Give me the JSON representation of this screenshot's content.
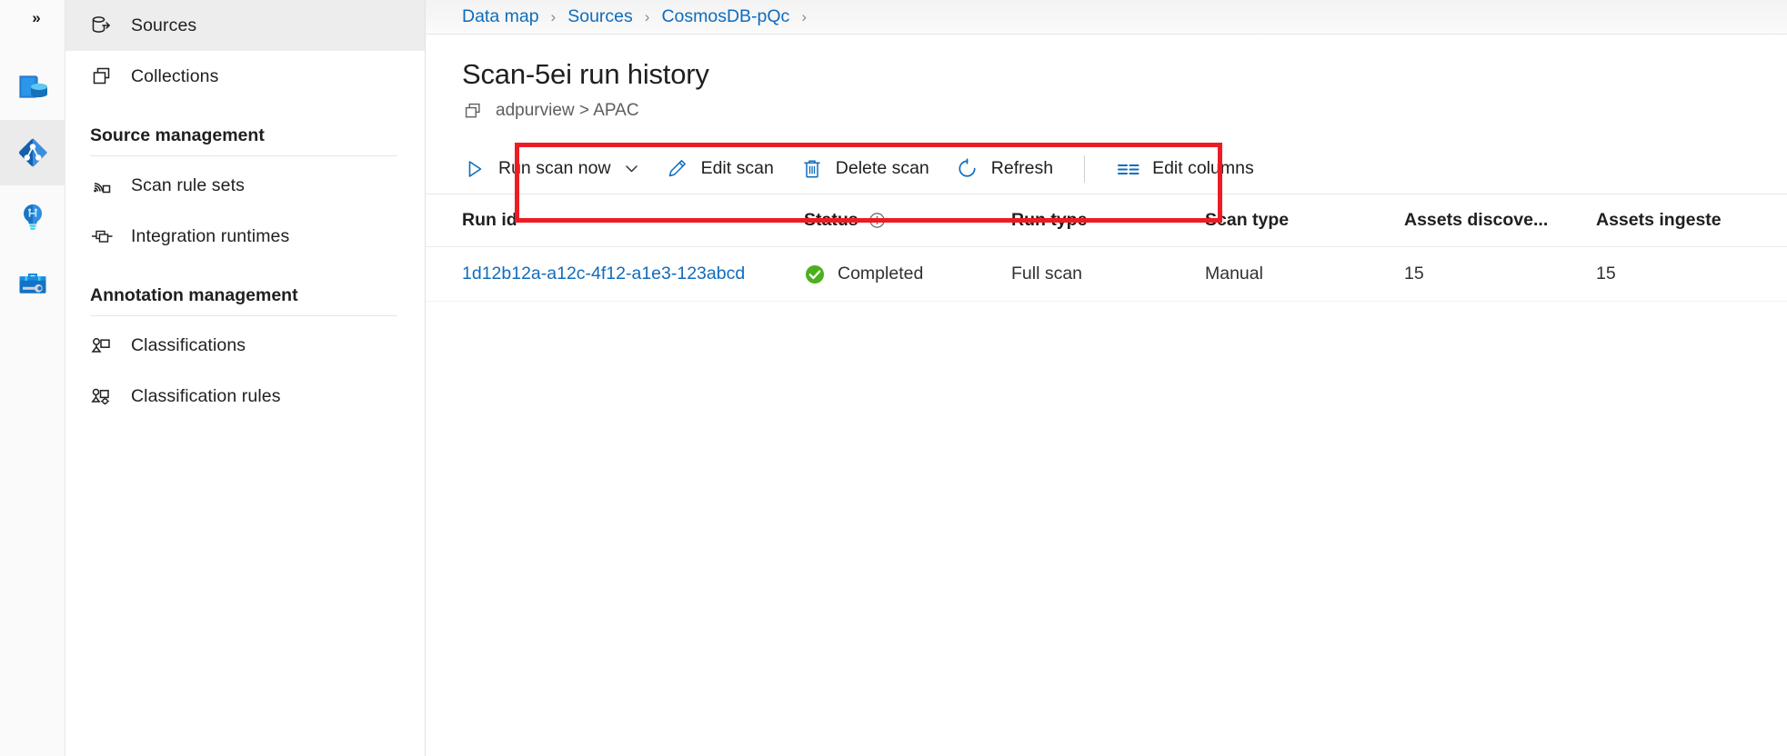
{
  "rail": {
    "items": [
      {
        "name": "data-catalog",
        "icon": "book-database-icon"
      },
      {
        "name": "data-map",
        "icon": "data-map-icon",
        "selected": true
      },
      {
        "name": "data-insights",
        "icon": "lightbulb-icon"
      },
      {
        "name": "management",
        "icon": "toolbox-icon"
      }
    ]
  },
  "sidebar": {
    "collapse_label": "»",
    "items": [
      {
        "label": "Sources",
        "icon": "sources-icon",
        "selected": true
      },
      {
        "label": "Collections",
        "icon": "collections-icon",
        "selected": false
      }
    ],
    "groups": [
      {
        "title": "Source management",
        "items": [
          {
            "label": "Scan rule sets",
            "icon": "scan-rule-sets-icon"
          },
          {
            "label": "Integration runtimes",
            "icon": "integration-runtimes-icon"
          }
        ]
      },
      {
        "title": "Annotation management",
        "items": [
          {
            "label": "Classifications",
            "icon": "classifications-icon"
          },
          {
            "label": "Classification rules",
            "icon": "classification-rules-icon"
          }
        ]
      }
    ]
  },
  "breadcrumb": {
    "items": [
      "Data map",
      "Sources",
      "CosmosDB-pQc"
    ],
    "separator": "›"
  },
  "page": {
    "title": "Scan-5ei run history",
    "subtitle": "adpurview > APAC",
    "subtitle_icon": "collections-icon"
  },
  "toolbar": {
    "commands": [
      {
        "label": "Run scan now",
        "icon": "play-icon",
        "has_chevron": true
      },
      {
        "label": "Edit scan",
        "icon": "pencil-icon",
        "has_chevron": false
      },
      {
        "label": "Delete scan",
        "icon": "trash-icon",
        "has_chevron": false
      },
      {
        "label": "Refresh",
        "icon": "refresh-icon",
        "has_chevron": false
      }
    ],
    "secondary": [
      {
        "label": "Edit columns",
        "icon": "edit-columns-icon"
      }
    ]
  },
  "table": {
    "columns": [
      {
        "key": "run_id",
        "label": "Run id",
        "info": false
      },
      {
        "key": "status",
        "label": "Status",
        "info": true
      },
      {
        "key": "run_type",
        "label": "Run type",
        "info": false
      },
      {
        "key": "scan_type",
        "label": "Scan type",
        "info": false
      },
      {
        "key": "assets_discovered",
        "label": "Assets discove...",
        "info": false
      },
      {
        "key": "assets_ingested",
        "label": "Assets ingeste",
        "info": false
      }
    ],
    "info_icon": "info-icon",
    "rows": [
      {
        "run_id": "1d12b12a-a12c-4f12-a1e3-123abcd",
        "status": "Completed",
        "status_icon": "check-circle-icon",
        "run_type": "Full scan",
        "scan_type": "Manual",
        "assets_discovered": "15",
        "assets_ingested": "15"
      }
    ]
  },
  "annotation": {
    "highlight_color": "#ec1c24",
    "name": "toolbar-highlight-box"
  },
  "colors": {
    "link": "#0f6cbd",
    "accent": "#0078d4",
    "success": "#4caf1d",
    "text": "#201f1e",
    "muted": "#605e5c",
    "selected_bg": "#ededed"
  }
}
